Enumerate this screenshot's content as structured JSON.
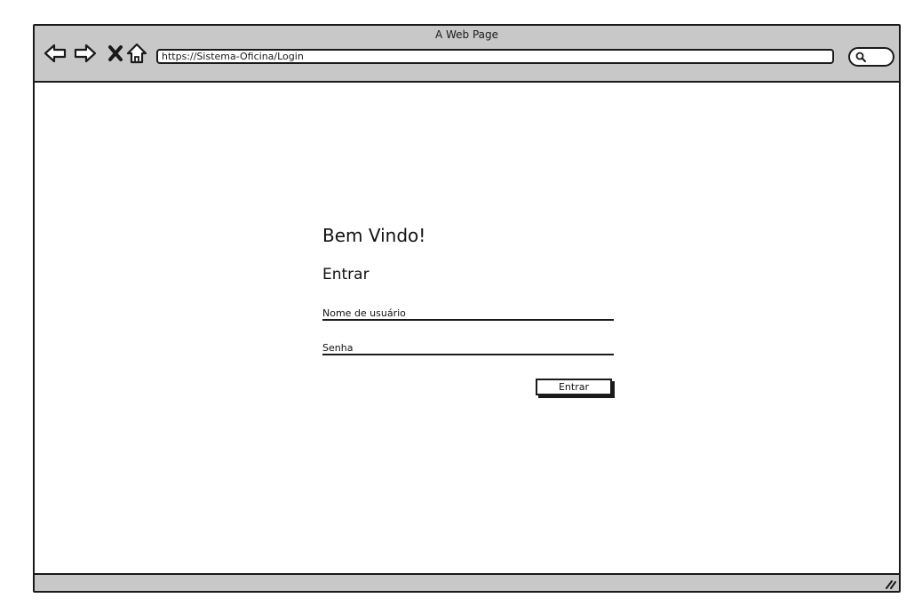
{
  "window": {
    "title": "A Web Page"
  },
  "toolbar": {
    "back_icon": "back-arrow-icon",
    "forward_icon": "forward-arrow-icon",
    "stop_icon": "close-icon",
    "home_icon": "home-icon",
    "url": "https://Sistema-Oficina/Login",
    "search_icon": "search-icon"
  },
  "login": {
    "heading": "Bem Vindo!",
    "subheading": "Entrar",
    "username_placeholder": "Nome de usuário",
    "password_placeholder": "Senha",
    "submit_label": "Entrar"
  },
  "colors": {
    "chrome": "#c8c8c8",
    "border": "#1a1a1a",
    "background": "#ffffff"
  }
}
